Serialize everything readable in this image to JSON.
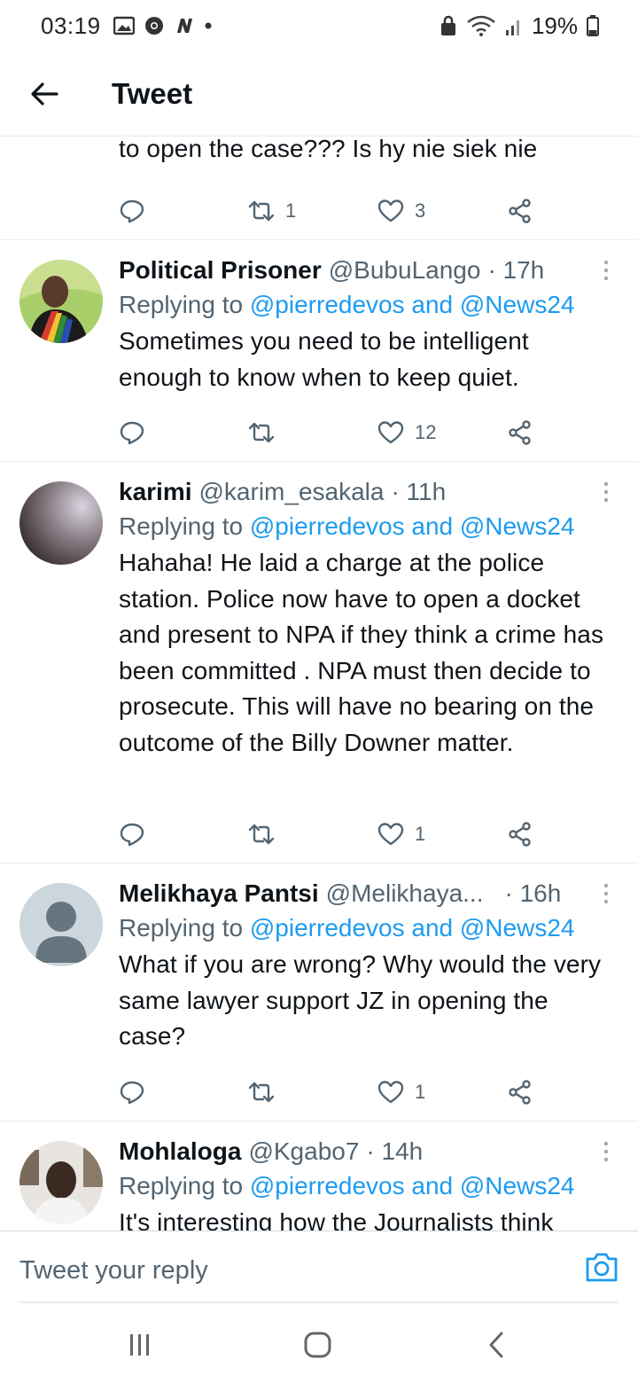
{
  "status_bar": {
    "time": "03:19",
    "battery": "19%",
    "icons": [
      "gallery-icon",
      "chrome-icon",
      "n-icon",
      "dot-icon",
      "lock-icon",
      "wifi-icon",
      "signal-icon",
      "battery-icon"
    ]
  },
  "header": {
    "title": "Tweet",
    "back_icon": "back-arrow-icon"
  },
  "partial_tweet": {
    "text": "to open the case??? Is hy nie siek nie",
    "retweets": "1",
    "likes": "3"
  },
  "tweets": [
    {
      "name": "Political Prisoner",
      "handle": "@BubuLango",
      "time": "· 17h",
      "replying_prefix": "Replying to ",
      "replying_to": "@pierredevos and @News24",
      "text": "Sometimes you need to be intelligent enough to know when to keep quiet.",
      "retweets": "",
      "likes": "12"
    },
    {
      "name": "karimi",
      "handle": "@karim_esakala",
      "time": "· 11h",
      "replying_prefix": "Replying to ",
      "replying_to": "@pierredevos and @News24",
      "text": "Hahaha! He laid a charge at the police station. Police now have to open a docket and present to NPA if they think a crime has been committed . NPA must then decide to prosecute. This will have no bearing on the outcome of the Billy Downer matter.",
      "retweets": "",
      "likes": "1"
    },
    {
      "name": "Melikhaya Pantsi",
      "handle": "@Melikhaya...",
      "time": "· 16h",
      "replying_prefix": "Replying to ",
      "replying_to": "@pierredevos and @News24",
      "text": "What if you are wrong? Why would the very same lawyer support JZ in opening the case?",
      "retweets": "",
      "likes": "1"
    },
    {
      "name": "Mohlaloga",
      "handle": "@Kgabo7",
      "time": "· 14h",
      "replying_prefix": "Replying to ",
      "replying_to": "@pierredevos and @News24",
      "text": "It's interesting how the Journalists think",
      "retweets": "",
      "likes": ""
    }
  ],
  "compose": {
    "placeholder": "Tweet your reply",
    "camera_icon": "camera-icon"
  },
  "nav_bar": {
    "icons": [
      "recents-icon",
      "home-icon",
      "back-icon"
    ]
  },
  "colors": {
    "link": "#1d9bf0",
    "secondary_text": "#536471",
    "primary_text": "#0f1419",
    "divider": "#e6ecf0"
  }
}
